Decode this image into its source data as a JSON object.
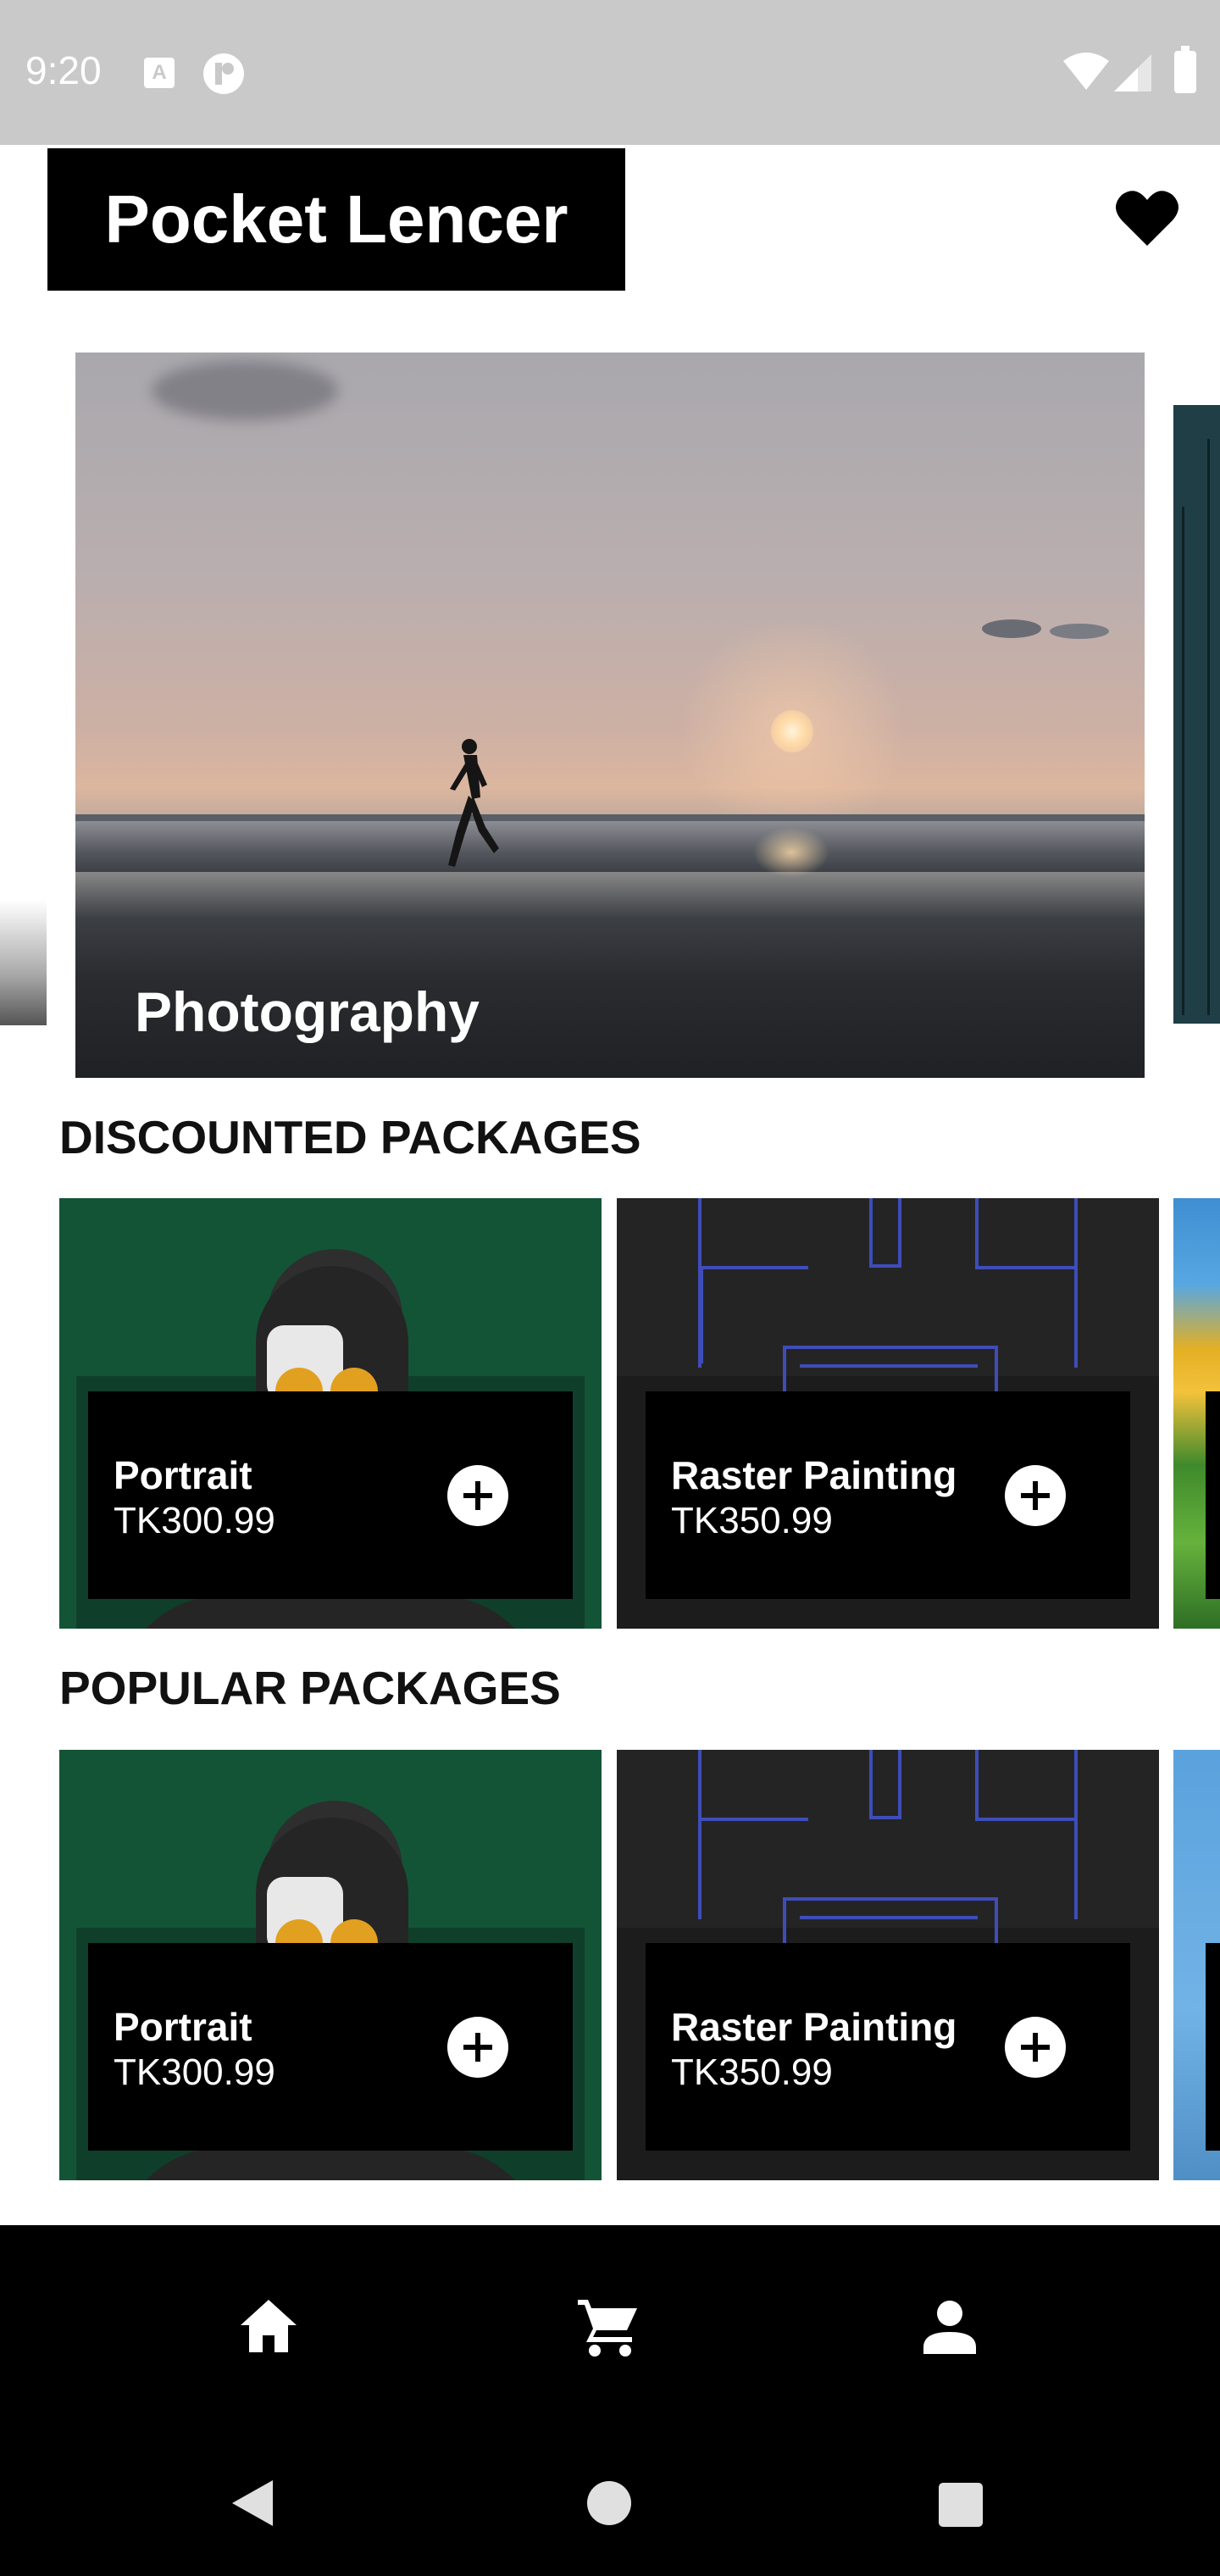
{
  "status_bar": {
    "time": "9:20",
    "icon_a_letter": "A"
  },
  "header": {
    "app_title": "Pocket Lencer"
  },
  "carousel": {
    "current_slide_title": "Photography"
  },
  "sections": [
    {
      "title": "DISCOUNTED PACKAGES",
      "cards": [
        {
          "name": "Portrait",
          "price": "TK300.99"
        },
        {
          "name": "Raster Painting",
          "price": "TK350.99"
        }
      ]
    },
    {
      "title": "POPULAR PACKAGES",
      "cards": [
        {
          "name": "Portrait",
          "price": "TK300.99"
        },
        {
          "name": "Raster Painting",
          "price": "TK350.99"
        }
      ]
    }
  ],
  "bottom_nav": {
    "items": [
      "home-icon",
      "cart-icon",
      "person-icon"
    ]
  },
  "colors": {
    "brand_black": "#000000",
    "card_green": "#135437",
    "card_dark": "#252424",
    "status_bar_grey": "#c9c9c9"
  }
}
